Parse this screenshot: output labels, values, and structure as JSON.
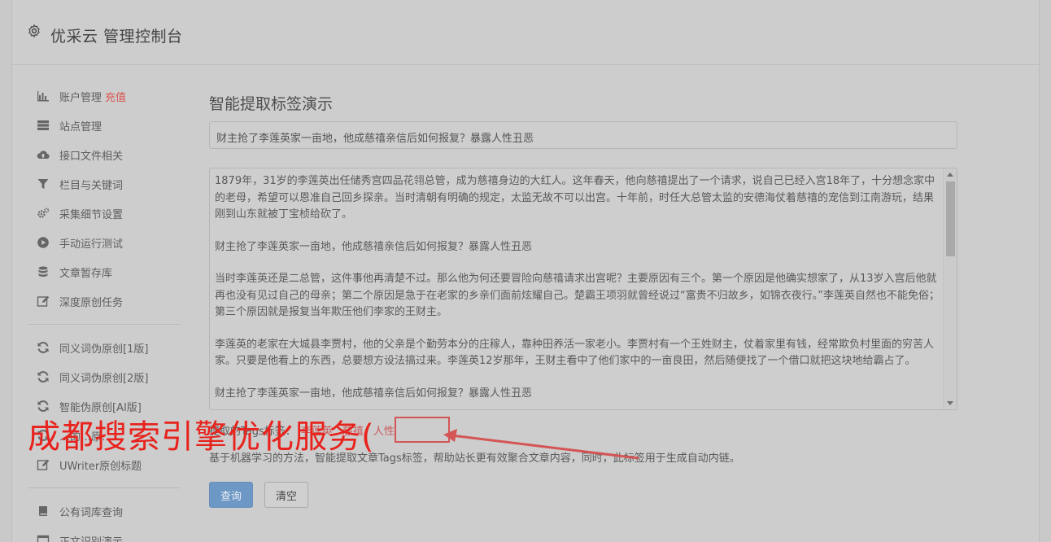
{
  "header": {
    "title": "优采云 管理控制台",
    "icon": "gear-icon"
  },
  "sidebar": {
    "group1": [
      {
        "label": "账户管理",
        "badge": "充值",
        "icon": "bar-chart-icon"
      },
      {
        "label": "站点管理",
        "icon": "server-icon"
      },
      {
        "label": "接口文件相关",
        "icon": "cloud-upload-icon"
      },
      {
        "label": "栏目与关键词",
        "icon": "filter-icon"
      },
      {
        "label": "采集细节设置",
        "icon": "gears-icon"
      },
      {
        "label": "手动运行测试",
        "icon": "play-circle-icon"
      },
      {
        "label": "文章暂存库",
        "icon": "database-icon"
      },
      {
        "label": "深度原创任务",
        "icon": "edit-icon"
      }
    ],
    "group2": [
      {
        "label": "同义词伪原创[1版]",
        "icon": "refresh-icon"
      },
      {
        "label": "同义词伪原创[2版]",
        "icon": "refresh-icon"
      },
      {
        "label": "智能伪原创[AI版]",
        "icon": "refresh-icon"
      },
      {
        "label": "…的…原…",
        "icon": "refresh-icon"
      },
      {
        "label": "UWriter原创标题",
        "icon": "edit-icon"
      }
    ],
    "group3": [
      {
        "label": "公有词库查询",
        "icon": "book-icon"
      },
      {
        "label": "正文识别演示",
        "icon": "window-icon"
      }
    ]
  },
  "main": {
    "heading": "智能提取标签演示",
    "title_value": "财主抢了李莲英家一亩地，他成慈禧亲信后如何报复？暴露人性丑恶",
    "content_paragraphs": [
      "1879年，31岁的李莲英出任储秀宫四品花翎总管，成为慈禧身边的大红人。这年春天，他向慈禧提出了一个请求，说自己已经入宫18年了，十分想念家中的老母，希望可以恩准自己回乡探亲。当时清朝有明确的规定，太监无故不可以出宫。十年前，时任大总管太监的安德海仗着慈禧的宠信到江南游玩，结果刚到山东就被丁宝桢给砍了。",
      "财主抢了李莲英家一亩地，他成慈禧亲信后如何报复？暴露人性丑恶",
      "当时李莲英还是二总管，这件事他再清楚不过。那么他为何还要冒险向慈禧请求出宫呢？主要原因有三个。第一个原因是他确实想家了，从13岁入宫后他就再也没有见过自己的母亲；第二个原因是急于在老家的乡亲们面前炫耀自己。楚霸王项羽就曾经说过“富贵不归故乡，如锦衣夜行。”李莲英自然也不能免俗；第三个原因就是报复当年欺压他们李家的王财主。",
      "李莲英的老家在大城县李贾村，他的父亲是个勤劳本分的庄稼人，靠种田养活一家老小。李贾村有一个王姓财主，仗着家里有钱，经常欺负村里面的穷苦人家。只要是他看上的东西，总要想方设法搞过来。李莲英12岁那年，王财主看中了他们家中的一亩良田，然后随便找了一个借口就把这块地给霸占了。",
      "财主抢了李莲英家一亩地，他成慈禧亲信后如何报复？暴露人性丑恶"
    ],
    "tags_label": "提取的Tags标签：",
    "tags": [
      "李莲英",
      "慈禧",
      "人性"
    ],
    "description": "基于机器学习的方法，智能提取文章Tags标签，帮助站长更有效聚合文章内容，同时，此标签用于生成自动内链。",
    "query_button": "查询",
    "clear_button": "清空"
  },
  "overlay": {
    "text": "成都搜索引擎优化服务(",
    "color": "#e8221c"
  }
}
